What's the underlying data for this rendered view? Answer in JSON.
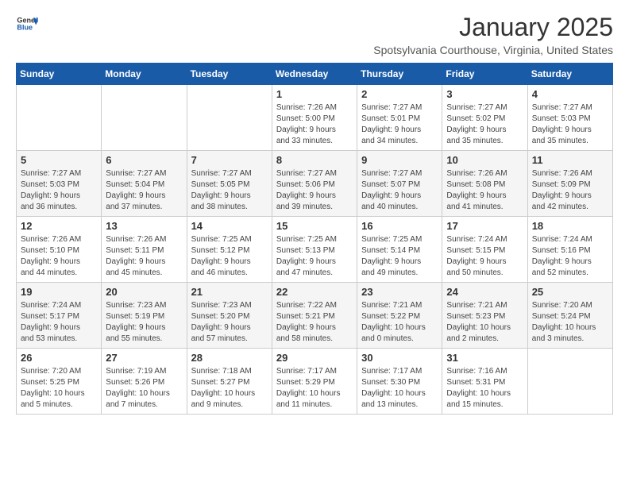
{
  "header": {
    "logo_general": "General",
    "logo_blue": "Blue",
    "title": "January 2025",
    "location": "Spotsylvania Courthouse, Virginia, United States"
  },
  "days_of_week": [
    "Sunday",
    "Monday",
    "Tuesday",
    "Wednesday",
    "Thursday",
    "Friday",
    "Saturday"
  ],
  "weeks": [
    [
      {
        "day": "",
        "info": ""
      },
      {
        "day": "",
        "info": ""
      },
      {
        "day": "",
        "info": ""
      },
      {
        "day": "1",
        "info": "Sunrise: 7:26 AM\nSunset: 5:00 PM\nDaylight: 9 hours\nand 33 minutes."
      },
      {
        "day": "2",
        "info": "Sunrise: 7:27 AM\nSunset: 5:01 PM\nDaylight: 9 hours\nand 34 minutes."
      },
      {
        "day": "3",
        "info": "Sunrise: 7:27 AM\nSunset: 5:02 PM\nDaylight: 9 hours\nand 35 minutes."
      },
      {
        "day": "4",
        "info": "Sunrise: 7:27 AM\nSunset: 5:03 PM\nDaylight: 9 hours\nand 35 minutes."
      }
    ],
    [
      {
        "day": "5",
        "info": "Sunrise: 7:27 AM\nSunset: 5:03 PM\nDaylight: 9 hours\nand 36 minutes."
      },
      {
        "day": "6",
        "info": "Sunrise: 7:27 AM\nSunset: 5:04 PM\nDaylight: 9 hours\nand 37 minutes."
      },
      {
        "day": "7",
        "info": "Sunrise: 7:27 AM\nSunset: 5:05 PM\nDaylight: 9 hours\nand 38 minutes."
      },
      {
        "day": "8",
        "info": "Sunrise: 7:27 AM\nSunset: 5:06 PM\nDaylight: 9 hours\nand 39 minutes."
      },
      {
        "day": "9",
        "info": "Sunrise: 7:27 AM\nSunset: 5:07 PM\nDaylight: 9 hours\nand 40 minutes."
      },
      {
        "day": "10",
        "info": "Sunrise: 7:26 AM\nSunset: 5:08 PM\nDaylight: 9 hours\nand 41 minutes."
      },
      {
        "day": "11",
        "info": "Sunrise: 7:26 AM\nSunset: 5:09 PM\nDaylight: 9 hours\nand 42 minutes."
      }
    ],
    [
      {
        "day": "12",
        "info": "Sunrise: 7:26 AM\nSunset: 5:10 PM\nDaylight: 9 hours\nand 44 minutes."
      },
      {
        "day": "13",
        "info": "Sunrise: 7:26 AM\nSunset: 5:11 PM\nDaylight: 9 hours\nand 45 minutes."
      },
      {
        "day": "14",
        "info": "Sunrise: 7:25 AM\nSunset: 5:12 PM\nDaylight: 9 hours\nand 46 minutes."
      },
      {
        "day": "15",
        "info": "Sunrise: 7:25 AM\nSunset: 5:13 PM\nDaylight: 9 hours\nand 47 minutes."
      },
      {
        "day": "16",
        "info": "Sunrise: 7:25 AM\nSunset: 5:14 PM\nDaylight: 9 hours\nand 49 minutes."
      },
      {
        "day": "17",
        "info": "Sunrise: 7:24 AM\nSunset: 5:15 PM\nDaylight: 9 hours\nand 50 minutes."
      },
      {
        "day": "18",
        "info": "Sunrise: 7:24 AM\nSunset: 5:16 PM\nDaylight: 9 hours\nand 52 minutes."
      }
    ],
    [
      {
        "day": "19",
        "info": "Sunrise: 7:24 AM\nSunset: 5:17 PM\nDaylight: 9 hours\nand 53 minutes."
      },
      {
        "day": "20",
        "info": "Sunrise: 7:23 AM\nSunset: 5:19 PM\nDaylight: 9 hours\nand 55 minutes."
      },
      {
        "day": "21",
        "info": "Sunrise: 7:23 AM\nSunset: 5:20 PM\nDaylight: 9 hours\nand 57 minutes."
      },
      {
        "day": "22",
        "info": "Sunrise: 7:22 AM\nSunset: 5:21 PM\nDaylight: 9 hours\nand 58 minutes."
      },
      {
        "day": "23",
        "info": "Sunrise: 7:21 AM\nSunset: 5:22 PM\nDaylight: 10 hours\nand 0 minutes."
      },
      {
        "day": "24",
        "info": "Sunrise: 7:21 AM\nSunset: 5:23 PM\nDaylight: 10 hours\nand 2 minutes."
      },
      {
        "day": "25",
        "info": "Sunrise: 7:20 AM\nSunset: 5:24 PM\nDaylight: 10 hours\nand 3 minutes."
      }
    ],
    [
      {
        "day": "26",
        "info": "Sunrise: 7:20 AM\nSunset: 5:25 PM\nDaylight: 10 hours\nand 5 minutes."
      },
      {
        "day": "27",
        "info": "Sunrise: 7:19 AM\nSunset: 5:26 PM\nDaylight: 10 hours\nand 7 minutes."
      },
      {
        "day": "28",
        "info": "Sunrise: 7:18 AM\nSunset: 5:27 PM\nDaylight: 10 hours\nand 9 minutes."
      },
      {
        "day": "29",
        "info": "Sunrise: 7:17 AM\nSunset: 5:29 PM\nDaylight: 10 hours\nand 11 minutes."
      },
      {
        "day": "30",
        "info": "Sunrise: 7:17 AM\nSunset: 5:30 PM\nDaylight: 10 hours\nand 13 minutes."
      },
      {
        "day": "31",
        "info": "Sunrise: 7:16 AM\nSunset: 5:31 PM\nDaylight: 10 hours\nand 15 minutes."
      },
      {
        "day": "",
        "info": ""
      }
    ]
  ]
}
